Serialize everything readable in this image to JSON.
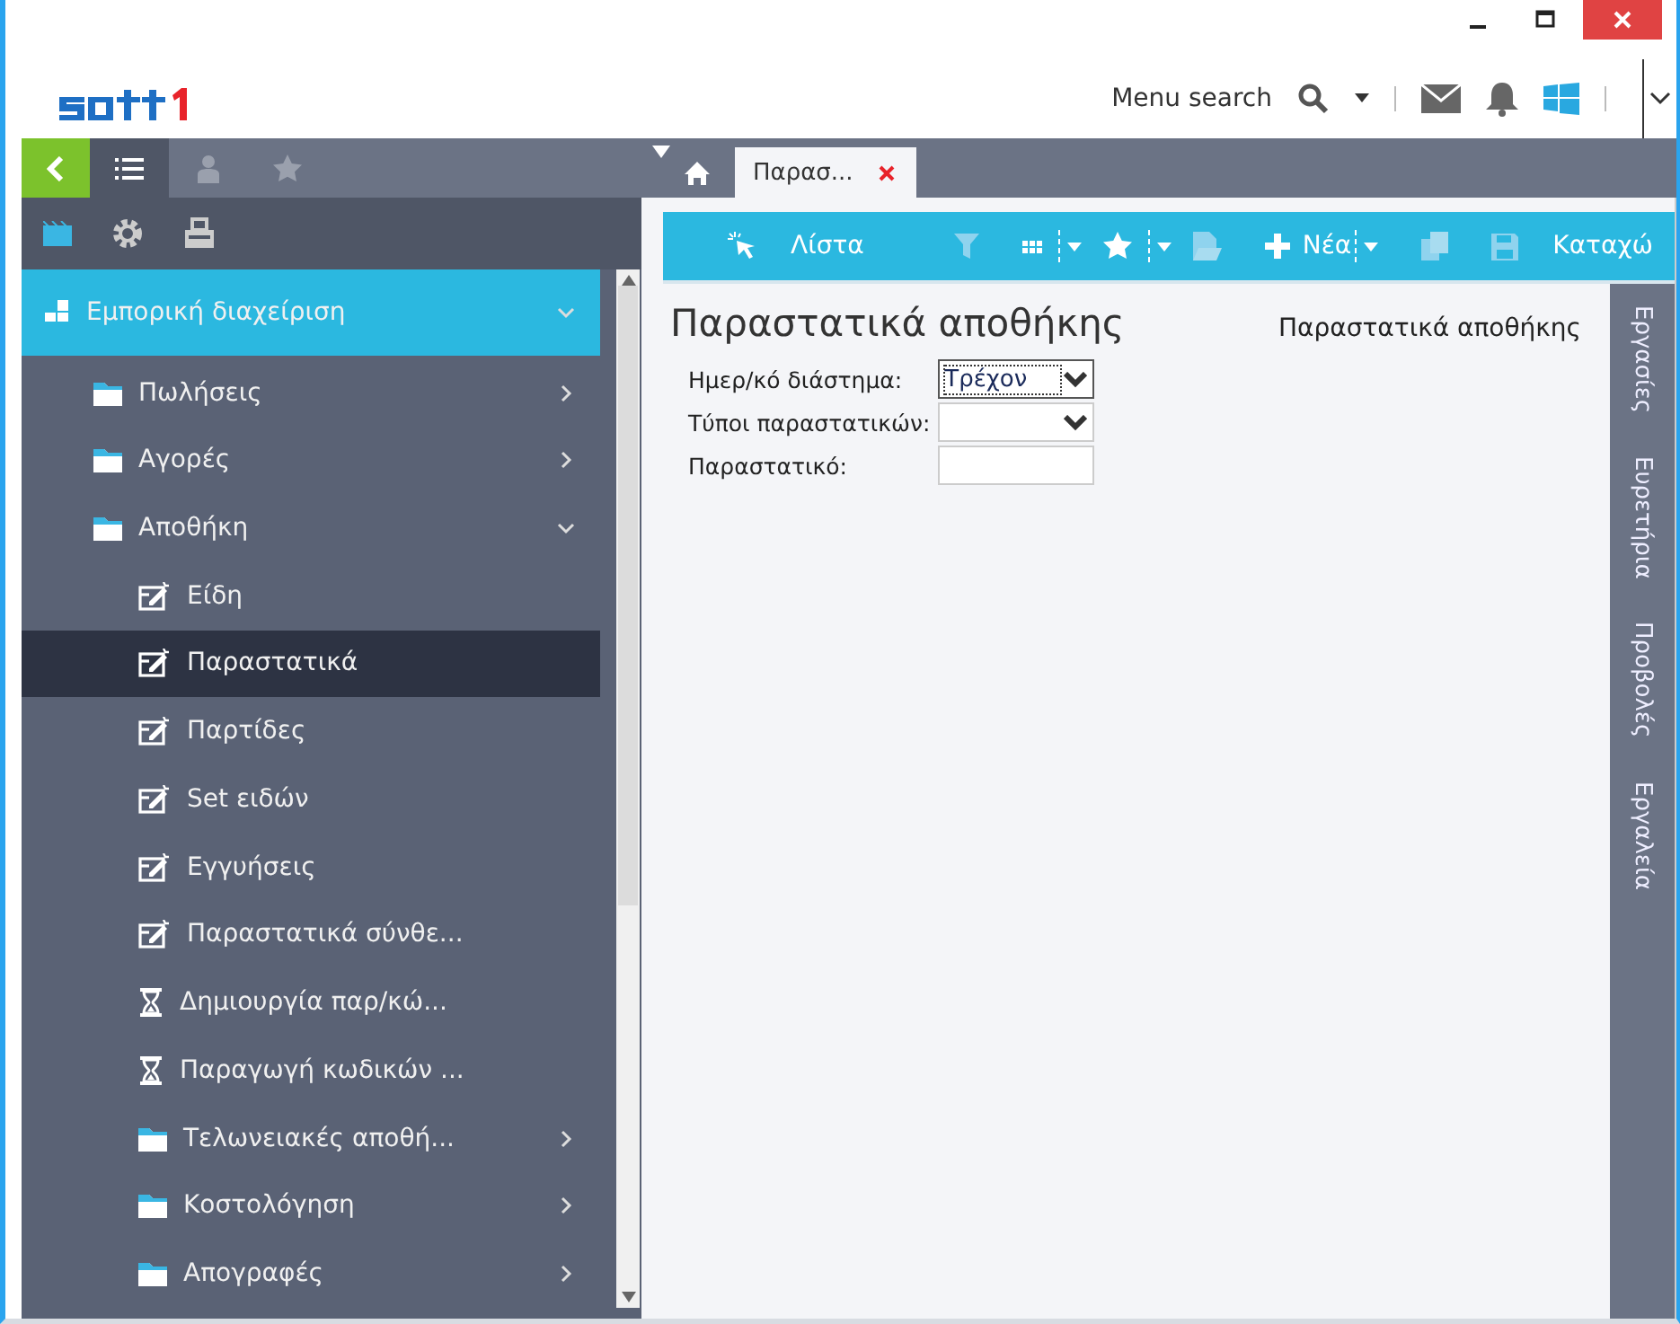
{
  "header": {
    "menu_search": "Menu search"
  },
  "sidebar": {
    "tabs": [
      {
        "kind": "list",
        "selected": true
      },
      {
        "kind": "user",
        "selected": false
      },
      {
        "kind": "star",
        "selected": false
      }
    ],
    "tree": [
      {
        "label": "Εμπορική διαχείριση",
        "kind": "module",
        "expanded": true,
        "selected": false,
        "children": [
          {
            "label": "Πωλήσεις",
            "kind": "folder",
            "expanded": false,
            "selected": false
          },
          {
            "label": "Αγορές",
            "kind": "folder",
            "expanded": false,
            "selected": false
          },
          {
            "label": "Αποθήκη",
            "kind": "folder",
            "expanded": true,
            "selected": false,
            "children": [
              {
                "label": "Είδη",
                "kind": "form",
                "selected": false
              },
              {
                "label": "Παραστατικά",
                "kind": "form",
                "selected": true
              },
              {
                "label": "Παρτίδες",
                "kind": "form",
                "selected": false
              },
              {
                "label": "Set ειδών",
                "kind": "form",
                "selected": false
              },
              {
                "label": "Εγγυήσεις",
                "kind": "form",
                "selected": false
              },
              {
                "label": "Παραστατικά σύνθε...",
                "kind": "form",
                "selected": false
              },
              {
                "label": "Δημιουργία παρ/κώ...",
                "kind": "process",
                "selected": false
              },
              {
                "label": "Παραγωγή κωδικών ...",
                "kind": "process",
                "selected": false
              },
              {
                "label": "Τελωνειακές αποθή...",
                "kind": "folder",
                "expanded": false,
                "selected": false
              },
              {
                "label": "Κοστολόγηση",
                "kind": "folder",
                "expanded": false,
                "selected": false
              },
              {
                "label": "Απογραφές",
                "kind": "folder",
                "expanded": false,
                "selected": false
              }
            ]
          }
        ]
      }
    ]
  },
  "tabs": [
    {
      "label": "Παρασ...",
      "selected": true
    }
  ],
  "toolbar": [
    {
      "kind": "list",
      "label": "Λίστα"
    },
    {
      "kind": "filter"
    },
    {
      "kind": "grid",
      "dropdown": true
    },
    {
      "kind": "star",
      "dropdown": true
    },
    {
      "kind": "document"
    },
    {
      "kind": "new",
      "label": "Νέα",
      "dropdown": true
    },
    {
      "kind": "copy"
    },
    {
      "kind": "save",
      "label": "Καταχώ"
    }
  ],
  "form": {
    "title": "Παραστατικά αποθήκης",
    "subtitle": "Παραστατικά αποθήκης",
    "fields": [
      {
        "label": "Ημερ/κό διάστημα:",
        "kind": "select",
        "value": "Τρέχον",
        "focused": true
      },
      {
        "label": "Τύποι παραστατικών:",
        "kind": "select",
        "focused": false
      },
      {
        "label": "Παραστατικό:",
        "kind": "text",
        "focused": false
      }
    ]
  },
  "side_panel": [
    "Εργασίες",
    "Ευρετήρια",
    "Προβολές",
    "Εργαλεία"
  ]
}
